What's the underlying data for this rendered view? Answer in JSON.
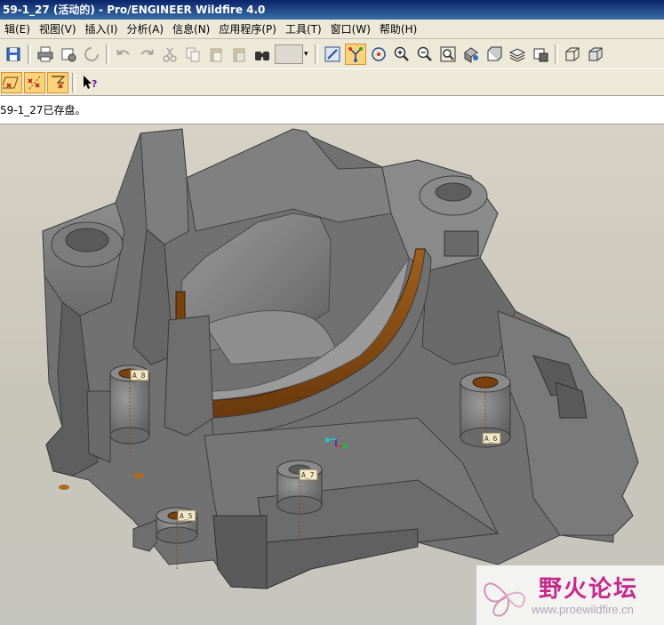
{
  "window": {
    "title": "59-1_27 (活动的) - Pro/ENGINEER Wildfire 4.0"
  },
  "menu": [
    {
      "label": "辑(E)"
    },
    {
      "label": "视图(V)"
    },
    {
      "label": "插入(I)"
    },
    {
      "label": "分析(A)"
    },
    {
      "label": "信息(N)"
    },
    {
      "label": "应用程序(P)"
    },
    {
      "label": "工具(T)"
    },
    {
      "label": "窗口(W)"
    },
    {
      "label": "帮助(H)"
    }
  ],
  "toolbar": {
    "icons": [
      "save-icon",
      "print-icon",
      "send-icon",
      "refresh-icon",
      "undo-icon",
      "redo-icon",
      "cut-icon",
      "copy-icon",
      "paste-icon",
      "paste-special-icon",
      "find-icon",
      "select-box",
      "repaint-icon",
      "spin-center-icon",
      "orient-icon",
      "zoom-in-icon",
      "zoom-out-icon",
      "refit-icon",
      "view-manager-icon",
      "saved-views-icon",
      "layers-icon",
      "model-display-icon",
      "wireframe-icon",
      "whats-this-icon"
    ]
  },
  "message": {
    "text": "59-1_27已存盘。"
  },
  "viewport": {
    "axis_tags": [
      {
        "label": "A_8"
      },
      {
        "label": "A_6"
      },
      {
        "label": "A_7"
      },
      {
        "label": "A_5"
      }
    ],
    "colors": {
      "part": "#6e6e6e",
      "accent": "#8a4a10",
      "background": "#cdcabe"
    }
  },
  "watermark": {
    "title": "野火论坛",
    "url": "www.proewildfire.cn"
  }
}
